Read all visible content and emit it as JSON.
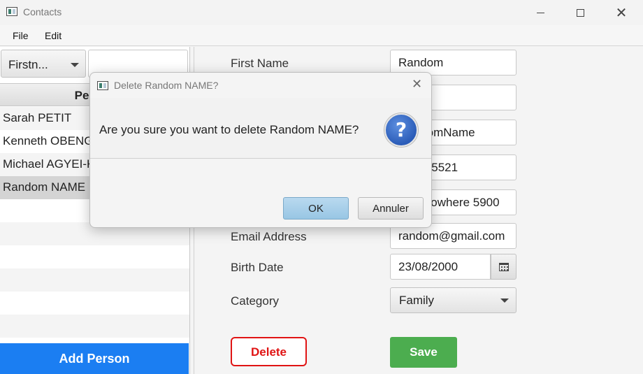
{
  "window": {
    "title": "Contacts",
    "controls": {
      "minimize": "minimize-icon",
      "maximize": "maximize-icon",
      "close": "close-icon"
    }
  },
  "menu": {
    "file": "File",
    "edit": "Edit"
  },
  "left_panel": {
    "filter_selected": "Firstn...",
    "search_value": "",
    "column_header": "Person",
    "rows": [
      {
        "name": "Sarah PETIT"
      },
      {
        "name": "Kenneth OBENG"
      },
      {
        "name": "Michael AGYEI-KODIE"
      },
      {
        "name": "Random NAME",
        "selected": true
      }
    ],
    "add_button": "Add Person",
    "colors": {
      "add_button": "#1b7ef2",
      "selected_row": "#d4d4d4"
    }
  },
  "form": {
    "first_name_label": "First Name",
    "first_name_value": "Random",
    "field2_value": "",
    "field3_value": "RandomName",
    "field4_value": "024995521",
    "field5_value": "Box Nowhere 5900",
    "email_label": "Email Address",
    "email_value": "random@gmail.com",
    "birth_date_label": "Birth Date",
    "birth_date_value": "23/08/2000",
    "category_label": "Category",
    "category_value": "Family",
    "delete_button": "Delete",
    "save_button": "Save",
    "colors": {
      "delete": "#e01414",
      "save": "#4cad4f"
    }
  },
  "dialog": {
    "title": "Delete Random NAME?",
    "message": "Are you sure you want to delete Random NAME?",
    "icon": "question-icon",
    "ok_button": "OK",
    "cancel_button": "Annuler"
  }
}
